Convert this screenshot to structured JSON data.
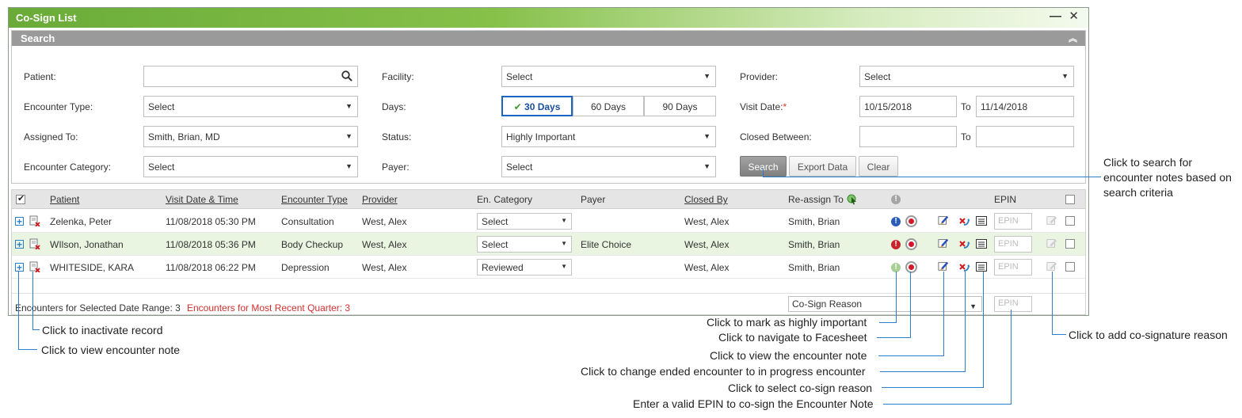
{
  "window": {
    "title": "Co-Sign List"
  },
  "search": {
    "header": "Search",
    "patient_label": "Patient:",
    "patient_value": "",
    "facility_label": "Facility:",
    "facility_value": "Select",
    "provider_label": "Provider:",
    "provider_value": "Select",
    "encounter_type_label": "Encounter Type:",
    "encounter_type_value": "Select",
    "days_label": "Days:",
    "days_options": [
      "30 Days",
      "60 Days",
      "90 Days"
    ],
    "days_selected": "30 Days",
    "visit_date_label": "Visit Date:",
    "visit_date_required": "*",
    "visit_date_from": "10/15/2018",
    "visit_date_to": "11/14/2018",
    "to_label": "To",
    "assigned_to_label": "Assigned To:",
    "assigned_to_value": "Smith, Brian, MD",
    "status_label": "Status:",
    "status_value": "Highly Important",
    "closed_between_label": "Closed Between:",
    "closed_from": "",
    "closed_to": "",
    "encounter_category_label": "Encounter Category:",
    "encounter_category_value": "Select",
    "payer_label": "Payer:",
    "payer_value": "Select",
    "buttons": {
      "search": "Search",
      "export": "Export Data",
      "clear": "Clear"
    }
  },
  "grid": {
    "columns": [
      "Patient",
      "Visit Date & Time",
      "Encounter Type",
      "Provider",
      "En. Category",
      "Payer",
      "Closed By",
      "Re-assign To",
      "EPIN"
    ],
    "rows": [
      {
        "patient": "Zelenka, Peter",
        "visit": "11/08/2018 05:30 PM",
        "type": "Consultation",
        "provider": "West, Alex",
        "category": "Select",
        "payer": "",
        "closed_by": "West, Alex",
        "reassign": "Smith, Brian",
        "epin": "EPIN",
        "priority": "blue"
      },
      {
        "patient": "WIlson, Jonathan",
        "visit": "11/08/2018 05:36 PM",
        "type": "Body Checkup",
        "provider": "West, Alex",
        "category": "Select",
        "payer": "Elite Choice",
        "closed_by": "West, Alex",
        "reassign": "Smith, Brian",
        "epin": "EPIN",
        "priority": "red"
      },
      {
        "patient": "WHITESIDE, KARA",
        "visit": "11/08/2018 06:22 PM",
        "type": "Depression",
        "provider": "West, Alex",
        "category": "Reviewed",
        "payer": "",
        "closed_by": "West, Alex",
        "reassign": "Smith, Brian",
        "epin": "EPIN",
        "priority": "gray"
      }
    ],
    "footer": {
      "count_text": "Encounters for Selected Date Range: 3",
      "quarter_text": "Encounters for Most Recent Quarter: 3",
      "cosign_reason": "Co-Sign Reason",
      "epin_placeholder": "EPIN"
    }
  },
  "callouts": {
    "search": [
      "Click to search for",
      "encounter notes based on",
      "search criteria"
    ],
    "inactivate": "Click to inactivate record",
    "view_note_left": "Click to view encounter note",
    "highly_important": "Click to mark as highly important",
    "facesheet": "Click to navigate to Facesheet",
    "view_note": "Click to view the encounter note",
    "change_ended": "Click to change ended encounter to in progress encounter",
    "select_reason": "Click to select co-sign reason",
    "epin": "Enter a valid EPIN to co-sign the Encounter Note",
    "add_reason": "Click to add co-signature reason"
  },
  "colors": {
    "accent": "#2a7fc8",
    "title_green": "#6aab38",
    "quarter_red": "#d32f2f"
  }
}
